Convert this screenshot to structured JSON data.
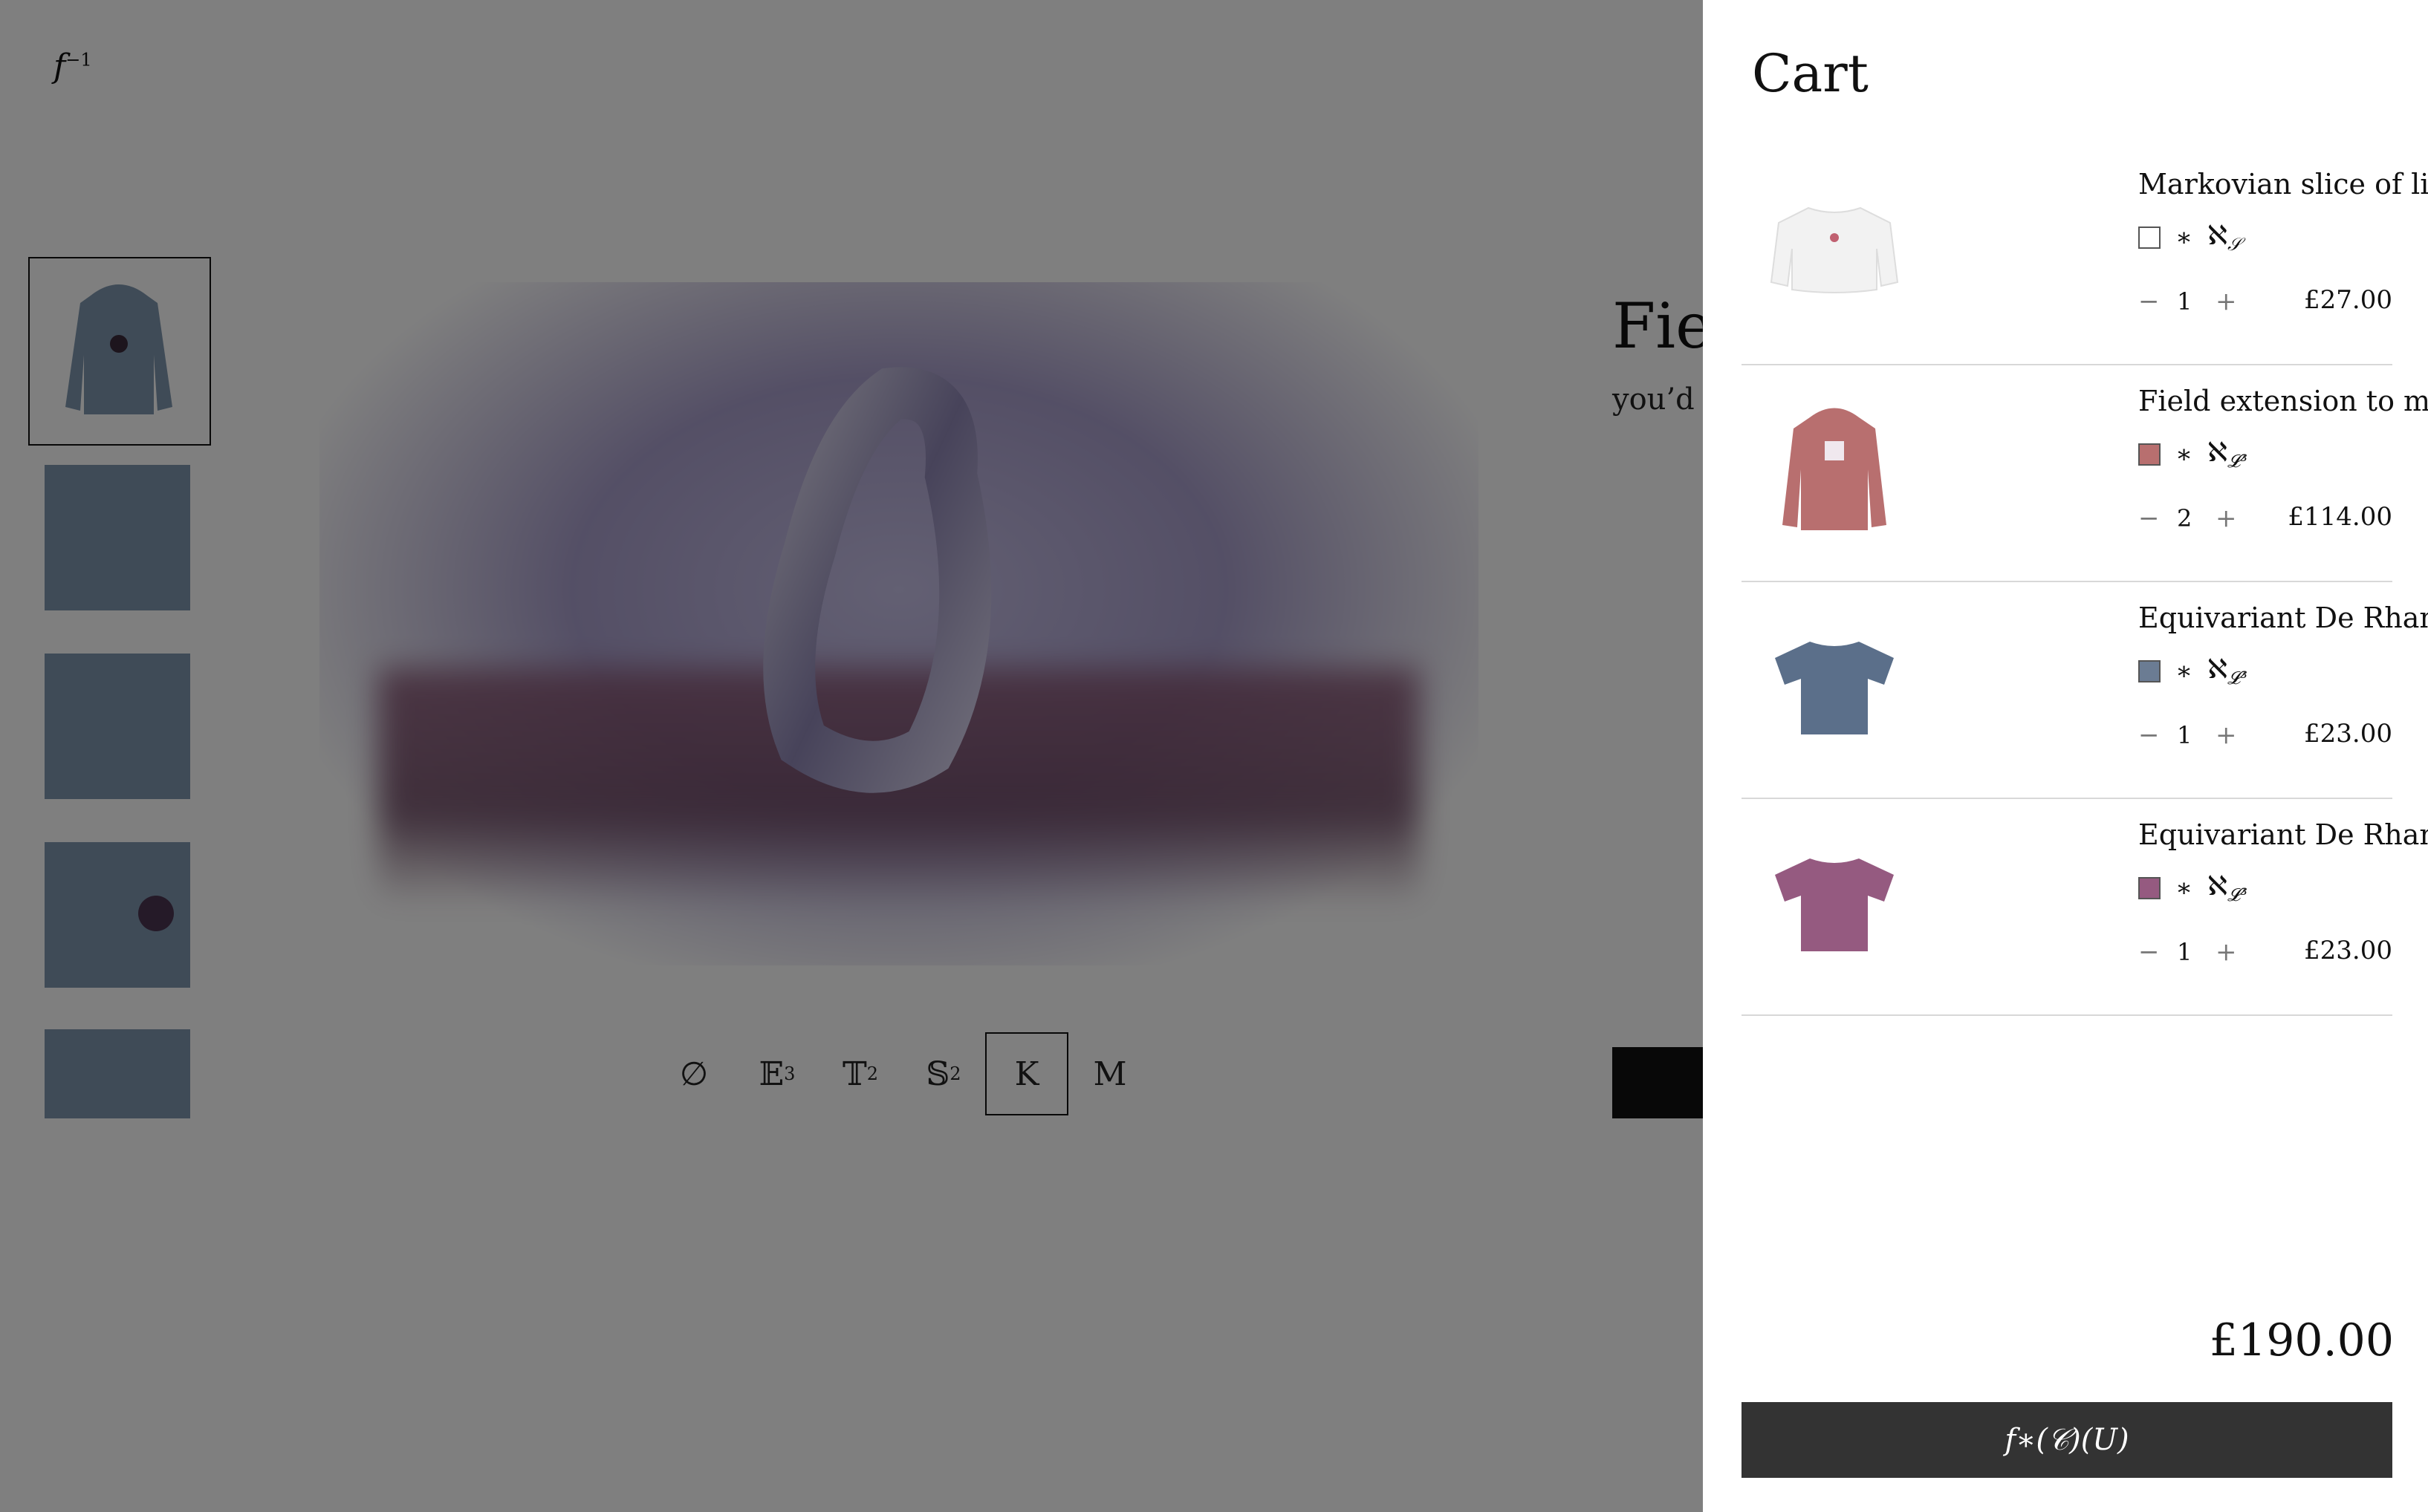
{
  "header": {
    "logo": "f",
    "logo_sup": "−1"
  },
  "product": {
    "title": "Fiel",
    "subtitle": "you’d c"
  },
  "manifolds": [
    {
      "label": "∅",
      "sup": "",
      "active": false
    },
    {
      "label": "𝔼",
      "sup": "3",
      "active": false
    },
    {
      "label": "𝕋",
      "sup": "2",
      "active": false
    },
    {
      "label": "𝕊",
      "sup": "2",
      "active": false
    },
    {
      "label": "K",
      "sup": "",
      "active": true
    },
    {
      "label": "M",
      "sup": "",
      "active": false
    }
  ],
  "cart": {
    "title": "Cart",
    "items": [
      {
        "name": "Markovian slice of life",
        "swatch_color": "#ffffff",
        "star": "∗",
        "aleph": "ℵ",
        "aleph_sub": "𝒮",
        "minus": "−",
        "qty": "1",
        "plus": "+",
        "price": "£27.00"
      },
      {
        "name": "Field extension to my heart",
        "swatch_color": "#b86f6f",
        "star": "∗",
        "aleph": "ℵ",
        "aleph_sub": "𝓛³",
        "minus": "−",
        "qty": "2",
        "plus": "+",
        "price": "£114.00"
      },
      {
        "name": "Equivariant De Rham",
        "swatch_color": "#6b7c93",
        "star": "∗",
        "aleph": "ℵ",
        "aleph_sub": "𝓛³",
        "minus": "−",
        "qty": "1",
        "plus": "+",
        "price": "£23.00"
      },
      {
        "name": "Equivariant De Rham",
        "swatch_color": "#955a80",
        "star": "∗",
        "aleph": "ℵ",
        "aleph_sub": "𝓛³",
        "minus": "−",
        "qty": "1",
        "plus": "+",
        "price": "£23.00"
      }
    ],
    "total": "£190.00",
    "checkout_label": "f∗(𝒞)(U)"
  },
  "colors": {
    "overlay": "rgba(0,0,0,0.5)",
    "checkout_bg": "#333333",
    "hoodie_blue": "#7f97ae",
    "hoodie_rose": "#b86f6f",
    "tee_slate": "#5b6f8a",
    "tee_plum": "#955a80"
  },
  "icons": {
    "product_images": [
      "white-sweatshirt-image",
      "rose-hoodie-image",
      "slate-tshirt-image",
      "plum-tshirt-image"
    ]
  }
}
